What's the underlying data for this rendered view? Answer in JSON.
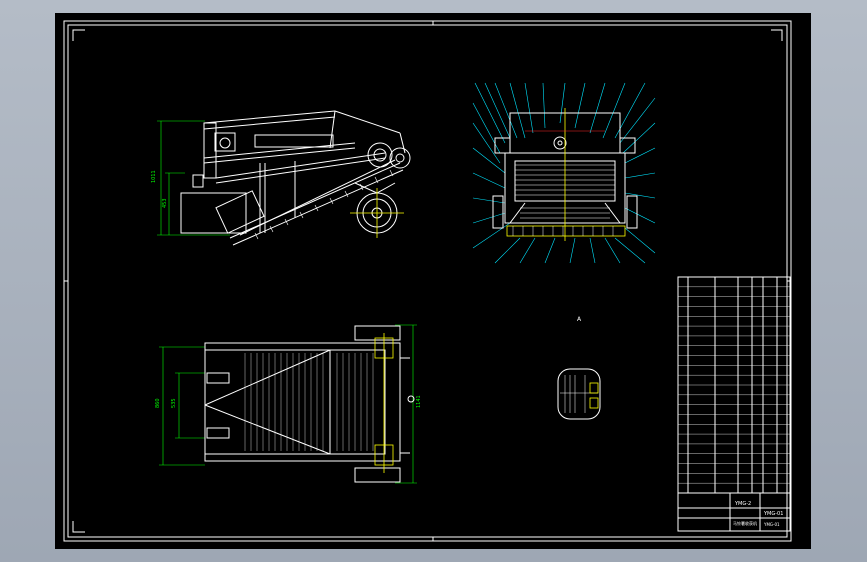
{
  "title_block": {
    "part_name": "YMG-2",
    "drawing_code": "YMG-01",
    "sheet_label": "马铃薯收获机"
  },
  "dimensions": {
    "side_view_height": "1011",
    "side_view_small": "453",
    "plan_view_width": "860",
    "plan_view_inner": "535",
    "plan_view_right": "1141"
  },
  "bom_row_count": 22,
  "colors": {
    "sheet": "#000000",
    "outline": "#ffffff",
    "centerline": "#ffff00",
    "leader": "#00e5ff",
    "dimension": "#00ff00",
    "hidden": "#ff2b2b"
  }
}
